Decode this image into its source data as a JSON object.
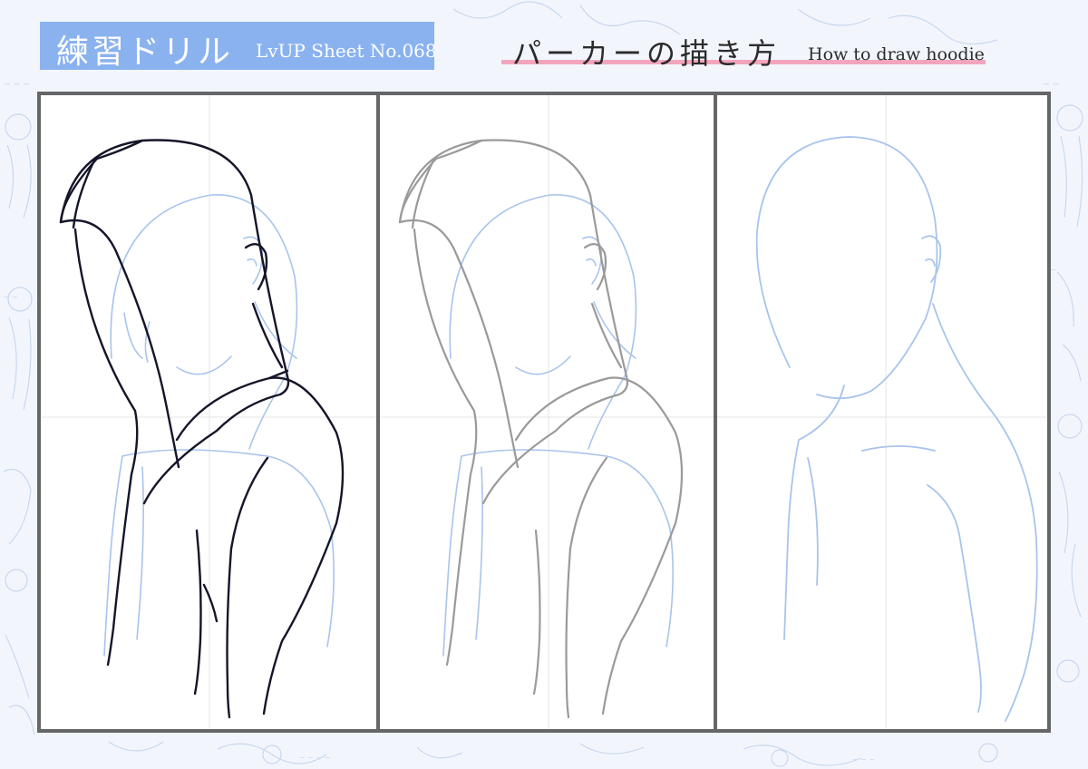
{
  "badge": {
    "title": "練習ドリル",
    "subtitle": "LvUP Sheet No.068",
    "color": "#8ab2ef"
  },
  "heading": {
    "japanese": "パーカーの描き方",
    "english": "How to draw hoodie",
    "underline_color": "#f2a5bd"
  },
  "panels": [
    {
      "stage": "finished line art over blue sketch",
      "line_color": "#15152a"
    },
    {
      "stage": "gray trace line art over blue sketch",
      "line_color": "#9a9a9a"
    },
    {
      "stage": "blue sketch only",
      "line_color": "#a9c4ec"
    }
  ],
  "colors": {
    "frame": "#666666",
    "sketch_blue": "#a9c4ec",
    "background": "#f2f6fc"
  }
}
